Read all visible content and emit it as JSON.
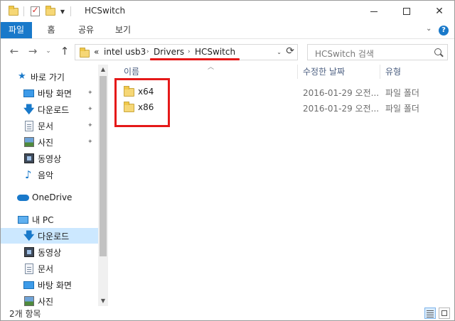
{
  "window": {
    "title": "HCSwitch",
    "minimize_label": "",
    "close_label": "✕"
  },
  "ribbon": {
    "tabs": [
      {
        "label": "파일",
        "active": true
      },
      {
        "label": "홈",
        "active": false
      },
      {
        "label": "공유",
        "active": false
      },
      {
        "label": "보기",
        "active": false
      }
    ],
    "expand_glyph": "⌄",
    "help_glyph": "?"
  },
  "nav": {
    "back": "←",
    "forward": "→",
    "recent": "⌄",
    "up": "↑",
    "address": {
      "overflow": "«",
      "crumbs": [
        "intel usb3",
        "Drivers",
        "HCSwitch"
      ],
      "separator": "›"
    },
    "search_placeholder": "HCSwitch 검색"
  },
  "sidebar": {
    "items": [
      {
        "label": "바로 가기",
        "icon": "star-icon"
      },
      {
        "label": "바탕 화면",
        "icon": "desktop-icon",
        "pinned": true
      },
      {
        "label": "다운로드",
        "icon": "download-icon",
        "pinned": true
      },
      {
        "label": "문서",
        "icon": "document-icon",
        "pinned": true
      },
      {
        "label": "사진",
        "icon": "picture-icon",
        "pinned": true
      },
      {
        "label": "동영상",
        "icon": "video-icon"
      },
      {
        "label": "음악",
        "icon": "music-icon"
      },
      {
        "label": "OneDrive",
        "icon": "onedrive-icon"
      },
      {
        "label": "내 PC",
        "icon": "pc-icon"
      },
      {
        "label": "다운로드",
        "icon": "download-icon",
        "selected": true
      },
      {
        "label": "동영상",
        "icon": "video-icon"
      },
      {
        "label": "문서",
        "icon": "document-icon"
      },
      {
        "label": "바탕 화면",
        "icon": "desktop-icon"
      },
      {
        "label": "사진",
        "icon": "picture-icon"
      }
    ],
    "pin_glyph": "📌"
  },
  "columns": {
    "name": "이름",
    "date": "수정한 날짜",
    "type": "유형"
  },
  "files": [
    {
      "name": "x64",
      "date": "2016-01-29 오전...",
      "type": "파일 폴더"
    },
    {
      "name": "x86",
      "date": "2016-01-29 오전...",
      "type": "파일 폴더"
    }
  ],
  "status": {
    "count": "2개 항목"
  },
  "colors": {
    "accent": "#1979ca",
    "annotation": "#e51919",
    "selection": "#cce8ff"
  }
}
